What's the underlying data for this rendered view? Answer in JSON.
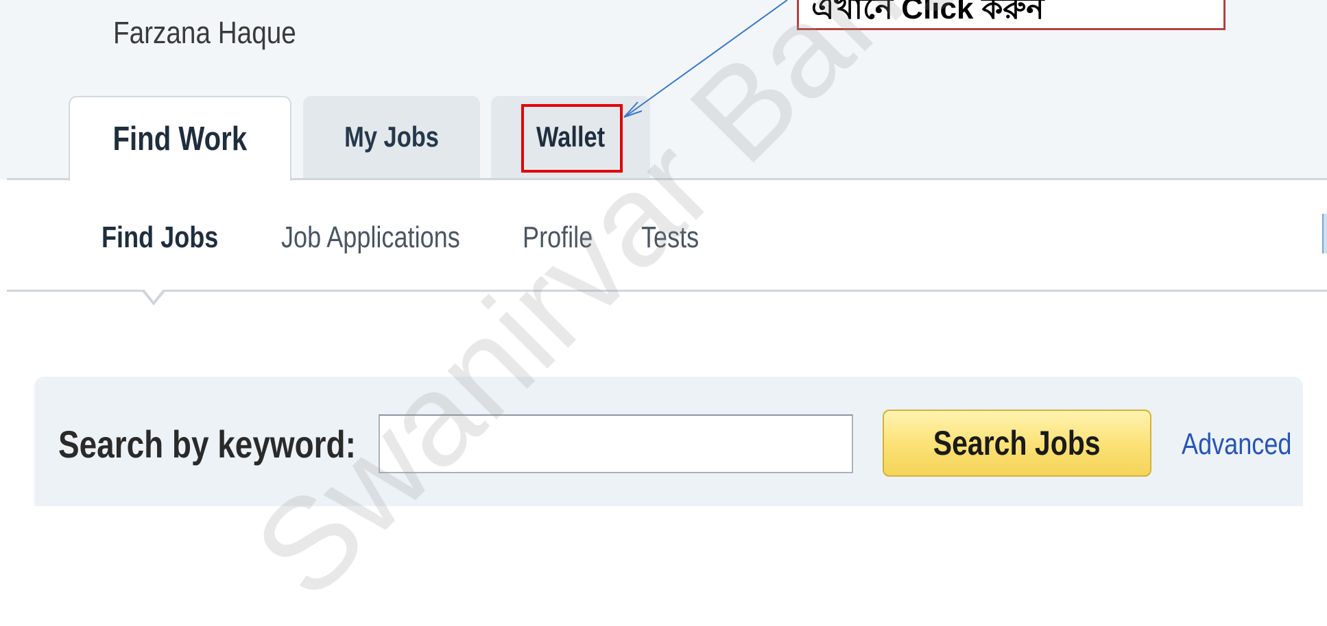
{
  "header": {
    "user_name": "Farzana Haque"
  },
  "tabs": [
    {
      "label": "Find Work",
      "active": true
    },
    {
      "label": "My Jobs",
      "active": false
    },
    {
      "label": "Wallet",
      "active": false,
      "highlighted": true
    }
  ],
  "subnav": {
    "items": [
      {
        "label": "Find Jobs",
        "active": true
      },
      {
        "label": "Job Applications",
        "active": false
      },
      {
        "label": "Profile",
        "active": false
      },
      {
        "label": "Tests",
        "active": false
      }
    ]
  },
  "search": {
    "label": "Search by keyword:",
    "input_value": "",
    "button_label": "Search Jobs",
    "advanced_label": "Advanced"
  },
  "callout": {
    "text": "এখানে Click করুন"
  },
  "watermark": {
    "text": "Swanirvar Bangla"
  },
  "colors": {
    "header_bg": "#f3f6f9",
    "inactive_tab_bg": "#e3e8ed",
    "highlight_border": "#e00000",
    "callout_border": "#b5403b",
    "arrow": "#3a78c9",
    "search_button": "#fbe073",
    "link": "#2755b5"
  }
}
